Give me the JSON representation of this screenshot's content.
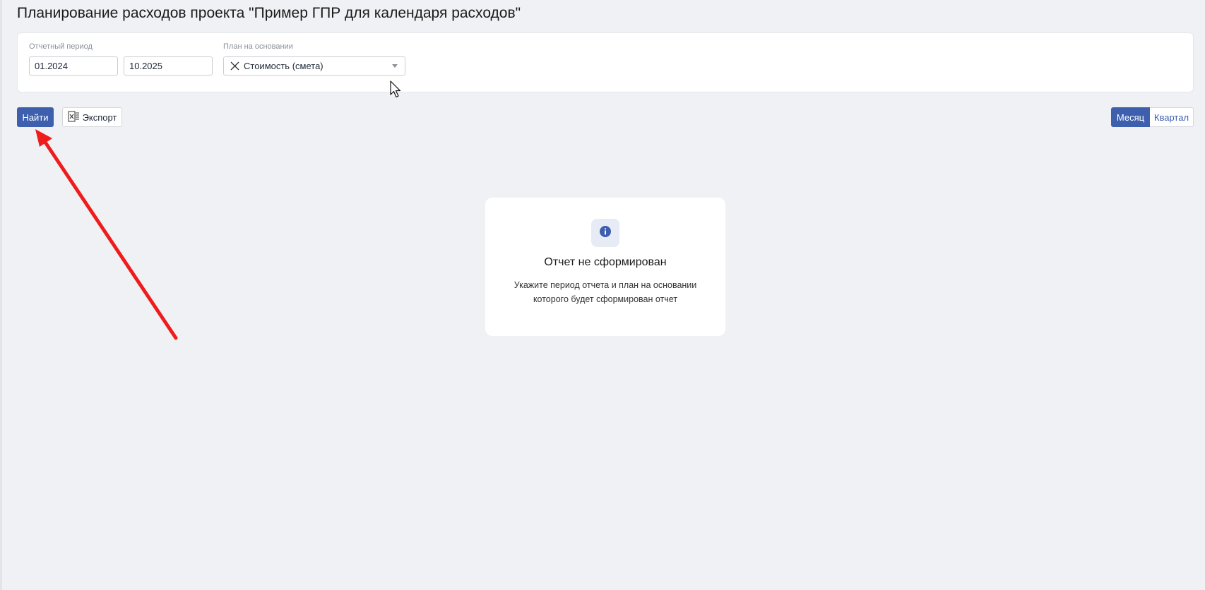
{
  "page": {
    "title": "Планирование расходов проекта \"Пример ГПР для календаря расходов\""
  },
  "filters": {
    "period_label": "Отчетный период",
    "period_from": "01.2024",
    "period_to": "10.2025",
    "plan_label": "План на основании",
    "plan_value": "Стоимость (смета)"
  },
  "toolbar": {
    "find_label": "Найти",
    "export_label": "Экспорт",
    "view_month_label": "Месяц",
    "view_quarter_label": "Квартал"
  },
  "empty_state": {
    "title": "Отчет не сформирован",
    "description": "Укажите период отчета и план на основании которого будет сформирован отчет"
  },
  "colors": {
    "primary": "#3d5fae",
    "annotation_arrow": "#ee1c1c",
    "background": "#f0f1f4"
  },
  "icons": {
    "clear": "close-icon",
    "dropdown": "chevron-down-icon",
    "export": "excel-icon",
    "info": "info-icon",
    "cursor": "mouse-pointer-icon"
  }
}
